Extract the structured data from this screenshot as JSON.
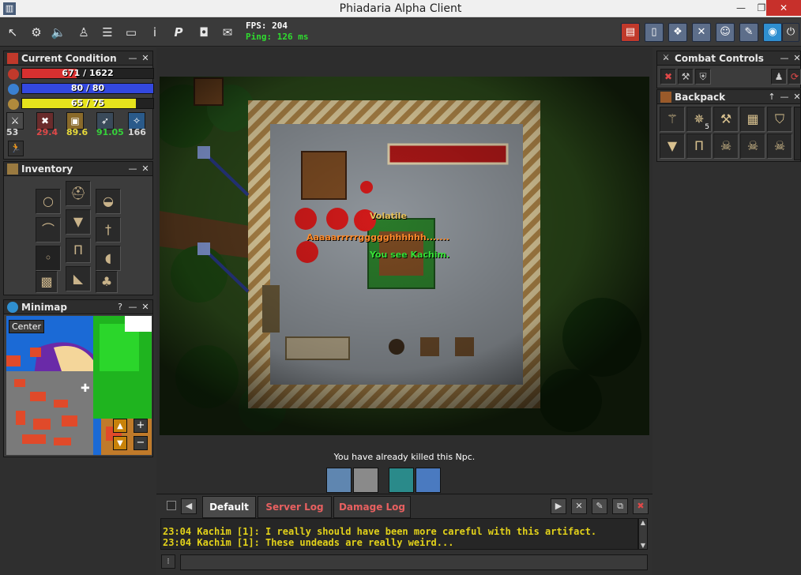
{
  "window": {
    "title": "Phiadaria Alpha Client",
    "minimize_glyph": "—",
    "restore_glyph": "❐",
    "close_glyph": "✕",
    "app_icon_glyph": "▥"
  },
  "toolbar": {
    "fps_label": "FPS: 204",
    "ping_label": "Ping: 126 ms",
    "fps_color": "#ffffff",
    "ping_color": "#2fdc2f",
    "left_icons": [
      {
        "name": "cursor-icon",
        "glyph": "↖"
      },
      {
        "name": "options-icon",
        "glyph": "⚙"
      },
      {
        "name": "sound-icon",
        "glyph": "🔈"
      },
      {
        "name": "character-icon",
        "glyph": "♙"
      },
      {
        "name": "notepad-icon",
        "glyph": "☰"
      },
      {
        "name": "window-icon",
        "glyph": "▭"
      },
      {
        "name": "info-icon",
        "glyph": "i"
      },
      {
        "name": "premium-icon",
        "glyph": "P"
      },
      {
        "name": "screenshot-icon",
        "glyph": "◘"
      },
      {
        "name": "scroll-icon",
        "glyph": "✉"
      }
    ],
    "right_icons": [
      {
        "name": "health-mana-toggle-icon",
        "glyph": "▤"
      },
      {
        "name": "notes-icon",
        "glyph": "▯"
      },
      {
        "name": "quest-log-icon",
        "glyph": "❖"
      },
      {
        "name": "combat-icon",
        "glyph": "✕"
      },
      {
        "name": "party-icon",
        "glyph": "☺"
      },
      {
        "name": "skills-icon",
        "glyph": "✎"
      },
      {
        "name": "world-map-icon",
        "glyph": "◉"
      },
      {
        "name": "logout-icon",
        "glyph": "⏻"
      }
    ]
  },
  "condition_panel": {
    "title": "Current Condition",
    "health": {
      "text": "671 / 1622",
      "current": 671,
      "max": 1622,
      "color": "#d73030"
    },
    "mana": {
      "text": "80 / 80",
      "current": 80,
      "max": 80,
      "color": "#3348e0"
    },
    "stamina": {
      "text": "65 / 75",
      "current": 65,
      "max": 75,
      "color": "#e6e31c"
    },
    "stats": [
      {
        "name": "level-icon",
        "glyph": "⚔",
        "value": "53",
        "color": "#d8d8d8"
      },
      {
        "name": "attack-icon",
        "glyph": "✖",
        "value": "29.4",
        "color": "#e04848"
      },
      {
        "name": "defense-icon",
        "glyph": "▣",
        "value": "89.6",
        "color": "#e6d93a"
      },
      {
        "name": "speed-icon",
        "glyph": "➶",
        "value": "91.05",
        "color": "#36d13a"
      },
      {
        "name": "magic-icon",
        "glyph": "✧",
        "value": "166",
        "color": "#d8d8d8"
      }
    ],
    "status_icon": "🏃"
  },
  "inventory_panel": {
    "title": "Inventory",
    "slots": [
      {
        "name": "amulet-slot",
        "glyph": "○"
      },
      {
        "name": "helmet-slot",
        "glyph": "⛑"
      },
      {
        "name": "backpack-slot",
        "glyph": "◒"
      },
      {
        "name": "bow-slot",
        "glyph": "⌒"
      },
      {
        "name": "armor-slot",
        "glyph": "▼"
      },
      {
        "name": "weapon-slot",
        "glyph": "†"
      },
      {
        "name": "ring-slot",
        "glyph": "◦"
      },
      {
        "name": "legs-slot",
        "glyph": "Π"
      },
      {
        "name": "shield-slot",
        "glyph": "◖"
      },
      {
        "name": "bag-slot",
        "glyph": "▩"
      },
      {
        "name": "boots-slot",
        "glyph": "◣"
      },
      {
        "name": "ammo-slot",
        "glyph": "♣"
      }
    ]
  },
  "minimap_panel": {
    "title": "Minimap",
    "center_label": "Center",
    "help_glyph": "?",
    "zoom_in": "+",
    "zoom_out": "−",
    "floor_up": "▲",
    "floor_down": "▼"
  },
  "combat_panel": {
    "title": "Combat Controls",
    "buttons": [
      {
        "name": "attack-mode-icon",
        "glyph": "✖"
      },
      {
        "name": "balanced-mode-icon",
        "glyph": "⚒"
      },
      {
        "name": "defense-mode-icon",
        "glyph": "⛨"
      },
      {
        "name": "follow-icon",
        "glyph": "♟"
      },
      {
        "name": "stop-icon",
        "glyph": "⟳"
      }
    ]
  },
  "backpack_panel": {
    "title": "Backpack",
    "up_glyph": "↑",
    "items": [
      {
        "name": "wand-item",
        "glyph": "⚚",
        "count": ""
      },
      {
        "name": "throwing-star-item",
        "glyph": "✵",
        "count": "5"
      },
      {
        "name": "axe-item",
        "glyph": "⚒",
        "count": ""
      },
      {
        "name": "spellbook-item",
        "glyph": "▦",
        "count": ""
      },
      {
        "name": "armor-item",
        "glyph": "⛉",
        "count": ""
      },
      {
        "name": "chest-armor-item",
        "glyph": "▼",
        "count": ""
      },
      {
        "name": "legs-item",
        "glyph": "Π",
        "count": ""
      },
      {
        "name": "skull-item",
        "glyph": "☠",
        "count": ""
      },
      {
        "name": "skull-item",
        "glyph": "☠",
        "count": ""
      },
      {
        "name": "skull-item",
        "glyph": "☠",
        "count": ""
      }
    ]
  },
  "game": {
    "npc_name": "Volatile",
    "npc_shout": "Aaaaarrrrrggggghhhhhh.......",
    "look_message": "You see Kachim.",
    "status_message": "You have already killed this Npc."
  },
  "chat": {
    "tabs": [
      {
        "label": "Default",
        "color": "#ffffff"
      },
      {
        "label": "Server Log",
        "color": "#e86060"
      },
      {
        "label": "Damage Log",
        "color": "#e86060"
      }
    ],
    "messages": [
      "23:04 Kachim [1]: I really should have been more careful with this artifact.",
      "23:04 Kachim [1]: These undeads are really weird..."
    ],
    "prev_glyph": "◀",
    "next_glyph": "▶",
    "close_glyph": "✕",
    "clear_glyph": "✎",
    "open_glyph": "⧉",
    "ignore_glyph": "✖",
    "scroll_up_glyph": "▲",
    "scroll_down_glyph": "▼",
    "input_icon_glyph": "⁝"
  }
}
